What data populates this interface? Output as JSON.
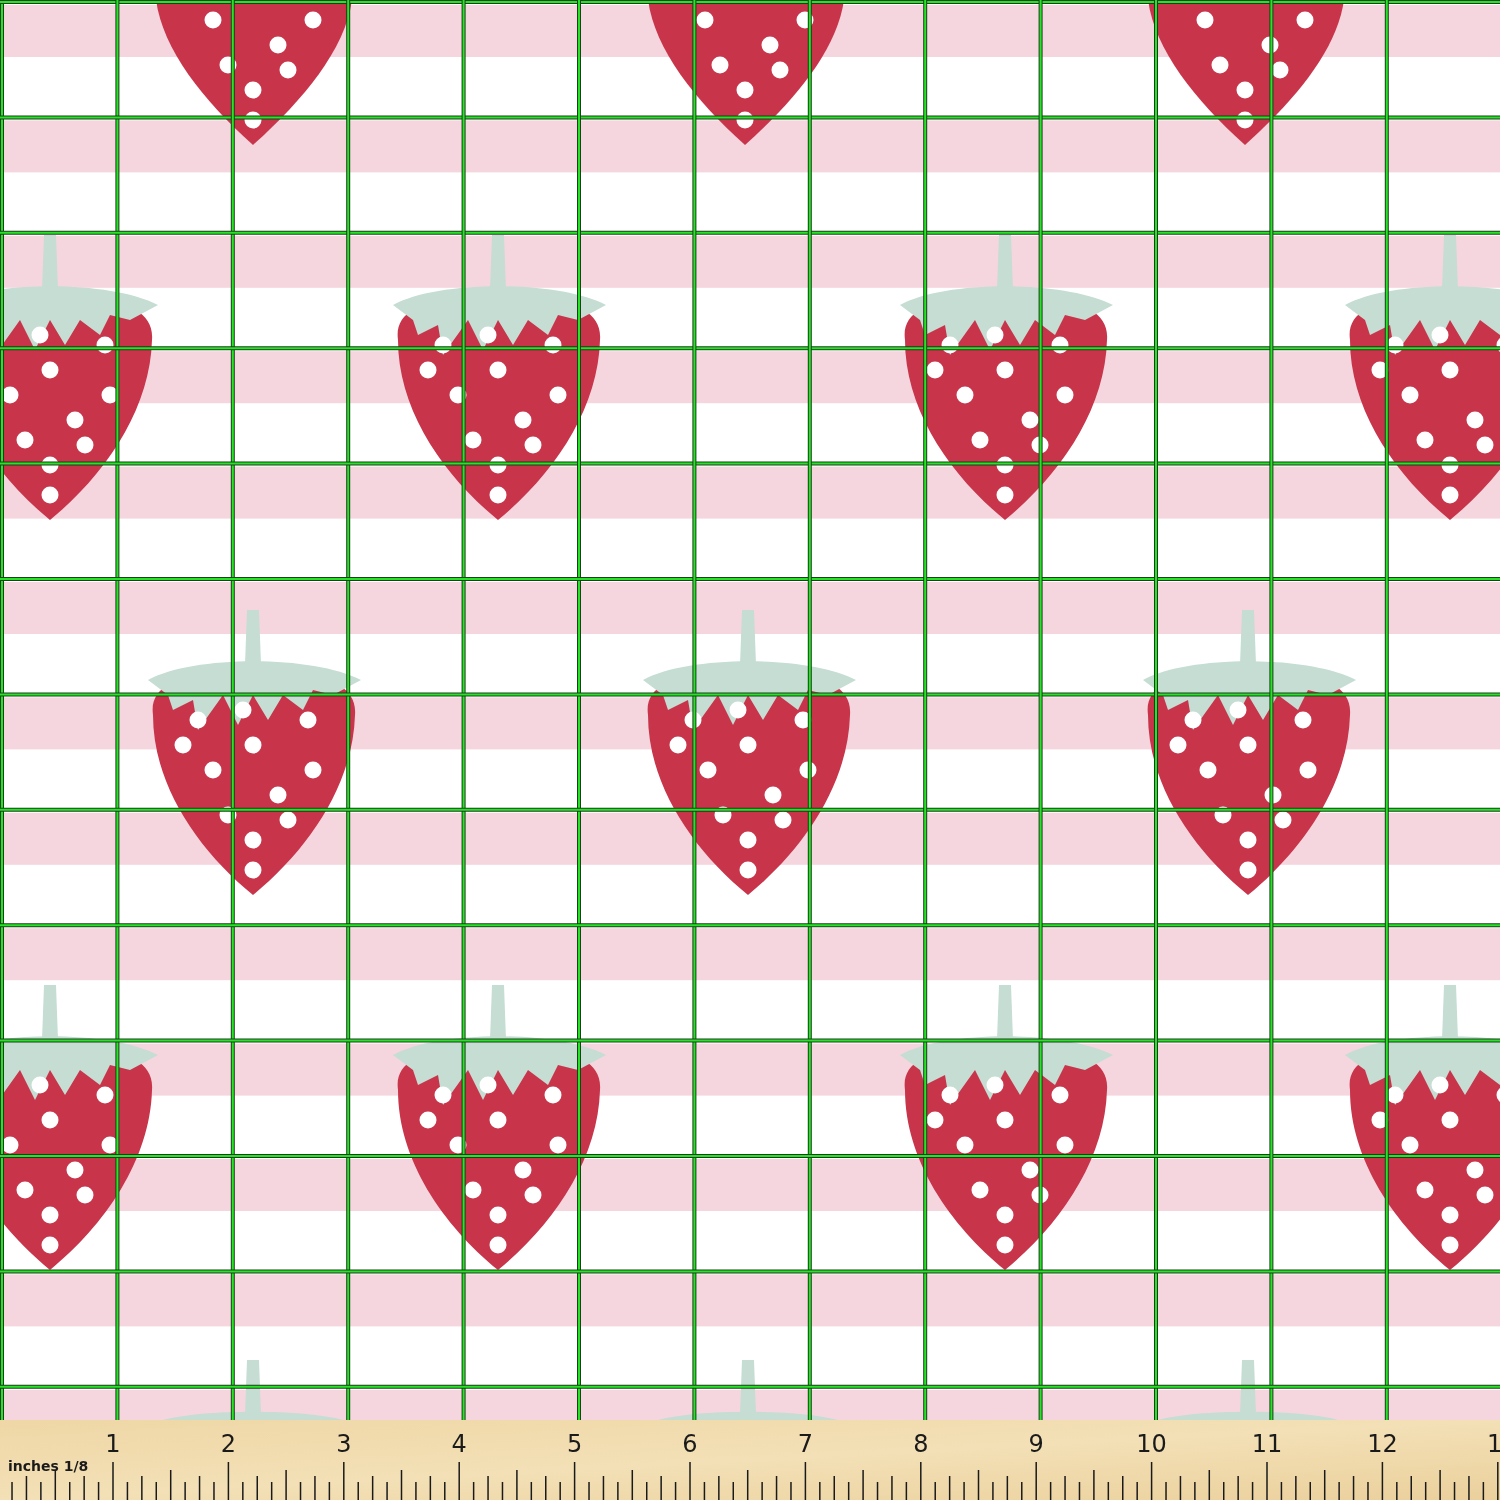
{
  "ruler": {
    "unit_label": "inches 1/8",
    "numbers": [
      "1",
      "2",
      "3",
      "4",
      "5",
      "6",
      "7",
      "8",
      "9",
      "10",
      "11",
      "12",
      "1"
    ]
  }
}
